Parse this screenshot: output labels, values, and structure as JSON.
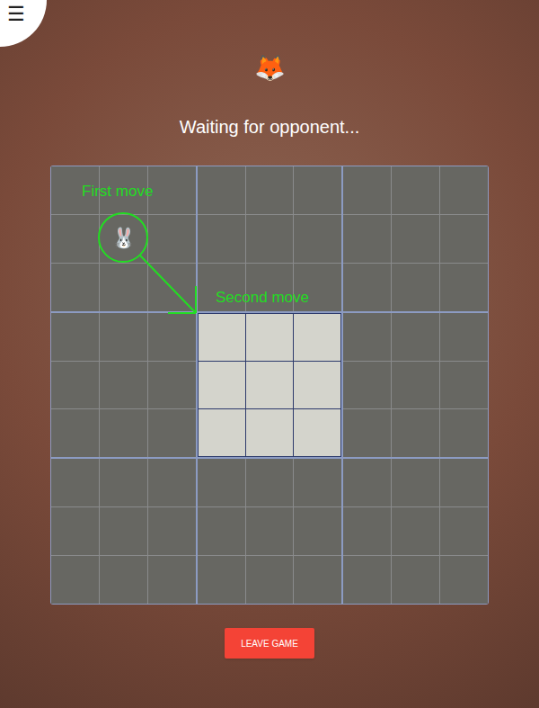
{
  "menu_icon": "☰",
  "player_icon": "🦊",
  "status": "Waiting for opponent...",
  "boards": [
    {
      "active": false,
      "cells": [
        "",
        "",
        "",
        "",
        "🐰",
        "",
        "",
        "",
        ""
      ]
    },
    {
      "active": false,
      "cells": [
        "",
        "",
        "",
        "",
        "",
        "",
        "",
        "",
        ""
      ]
    },
    {
      "active": false,
      "cells": [
        "",
        "",
        "",
        "",
        "",
        "",
        "",
        "",
        ""
      ]
    },
    {
      "active": false,
      "cells": [
        "",
        "",
        "",
        "",
        "",
        "",
        "",
        "",
        ""
      ]
    },
    {
      "active": true,
      "cells": [
        "",
        "",
        "",
        "",
        "",
        "",
        "",
        "",
        ""
      ]
    },
    {
      "active": false,
      "cells": [
        "",
        "",
        "",
        "",
        "",
        "",
        "",
        "",
        ""
      ]
    },
    {
      "active": false,
      "cells": [
        "",
        "",
        "",
        "",
        "",
        "",
        "",
        "",
        ""
      ]
    },
    {
      "active": false,
      "cells": [
        "",
        "",
        "",
        "",
        "",
        "",
        "",
        "",
        ""
      ]
    },
    {
      "active": false,
      "cells": [
        "",
        "",
        "",
        "",
        "",
        "",
        "",
        "",
        ""
      ]
    }
  ],
  "annotations": [
    {
      "text": "First move"
    },
    {
      "text": "Second move"
    }
  ],
  "buttons": [
    "LEAVE GAME"
  ]
}
